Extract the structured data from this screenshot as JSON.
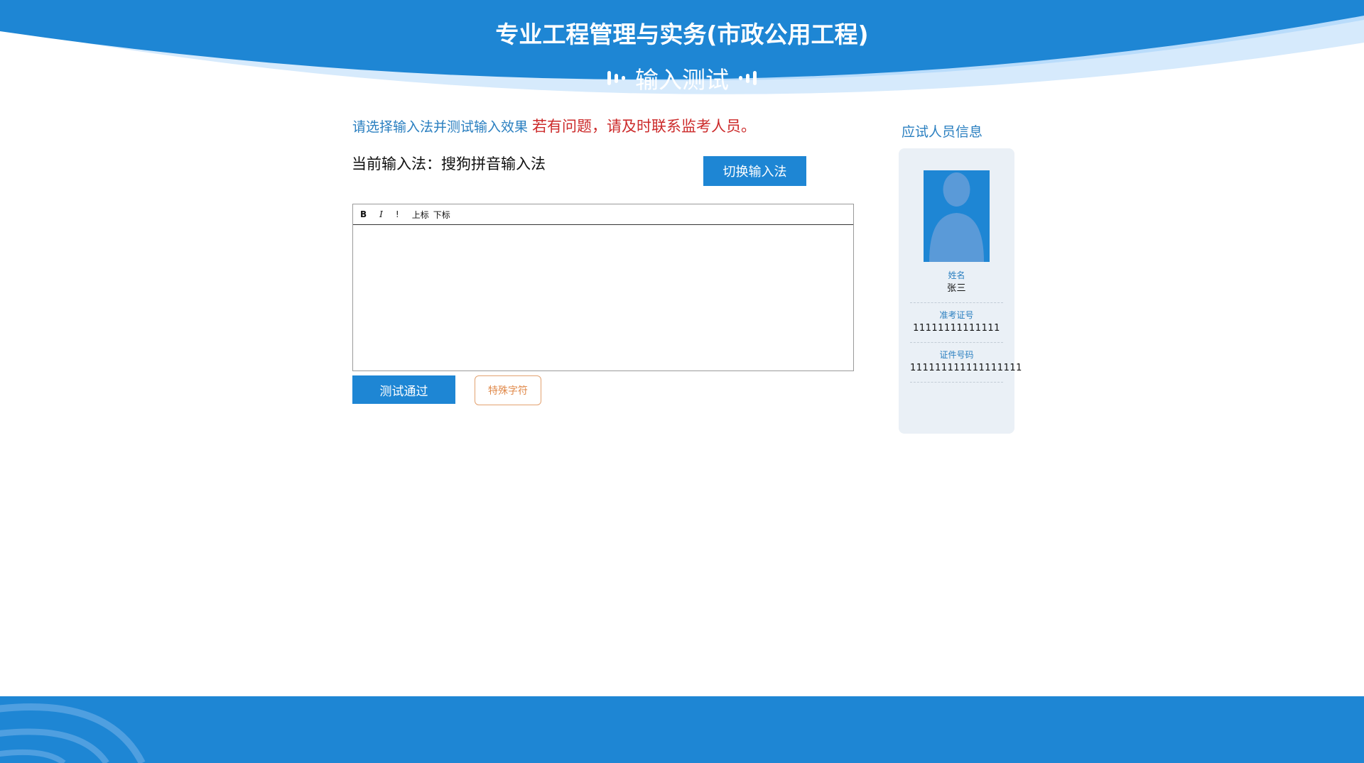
{
  "header": {
    "title": "专业工程管理与实务(市政公用工程)",
    "subtitle": "输入测试"
  },
  "instructions": {
    "hint": "请选择输入法并测试输入效果",
    "warning": "若有问题，请及时联系监考人员。"
  },
  "ime": {
    "current_label": "当前输入法：",
    "current_value": "搜狗拼音输入法",
    "switch_label": "切换输入法"
  },
  "editor": {
    "toolbar": {
      "bold": "B",
      "italic": "I",
      "exclaim": "!",
      "superscript": "上标",
      "subscript": "下标"
    },
    "content": ""
  },
  "actions": {
    "pass_label": "测试通过",
    "special_label": "特殊字符"
  },
  "candidate": {
    "title": "应试人员信息",
    "name_label": "姓名",
    "name_value": "张三",
    "ticket_label": "准考证号",
    "ticket_value": "11111111111111",
    "id_label": "证件号码",
    "id_value": "111111111111111111"
  },
  "colors": {
    "primary_blue": "#1e86d4",
    "light_blue": "#b9dcfb",
    "text_blue": "#2a7fc0",
    "warning_red": "#cc2a2a",
    "special_orange": "#e0894a",
    "card_bg": "#eaf0f6"
  }
}
